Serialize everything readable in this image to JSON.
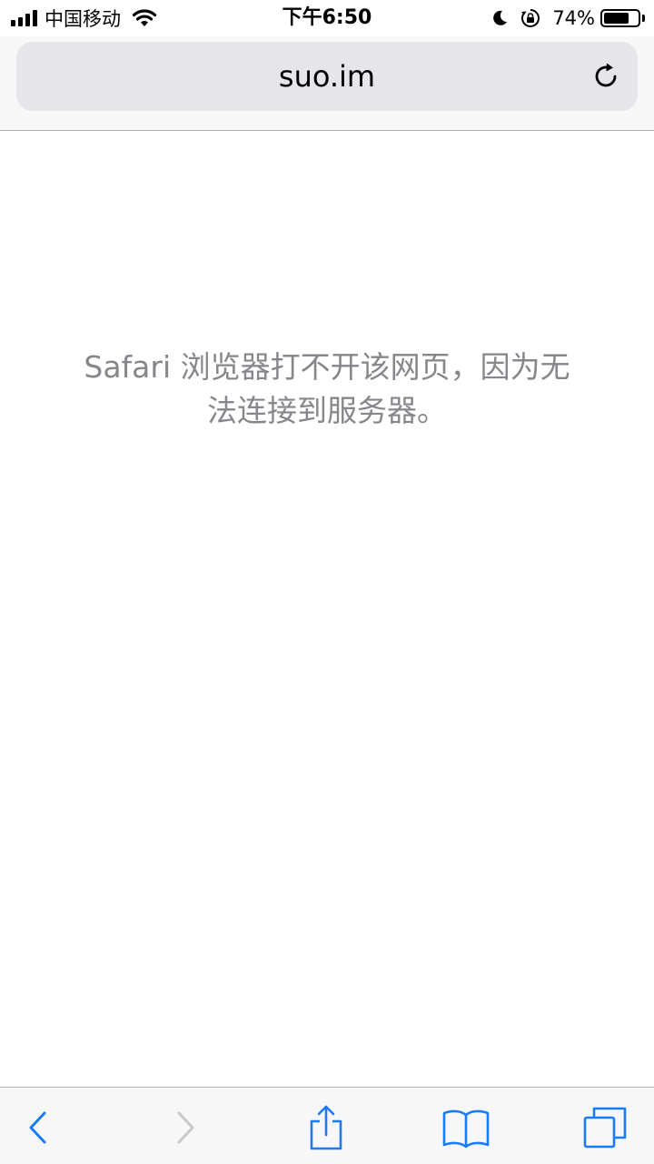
{
  "status_bar": {
    "carrier": "中国移动",
    "time": "下午6:50",
    "battery_percent": "74%",
    "battery_level": 0.74,
    "icons": [
      "signal-bars-icon",
      "wifi-icon",
      "moon-icon",
      "rotation-lock-icon",
      "battery-icon"
    ]
  },
  "address_bar": {
    "url": "suo.im",
    "reload_icon": "reload-icon"
  },
  "content": {
    "error_message": "Safari 浏览器打不开该网页，因为无法连接到服务器。"
  },
  "toolbar": {
    "icons": [
      "back-icon",
      "forward-icon",
      "share-icon",
      "bookmarks-icon",
      "tabs-icon"
    ],
    "accent_color": "#1a7cf5",
    "disabled_color": "#c7c7cc"
  }
}
